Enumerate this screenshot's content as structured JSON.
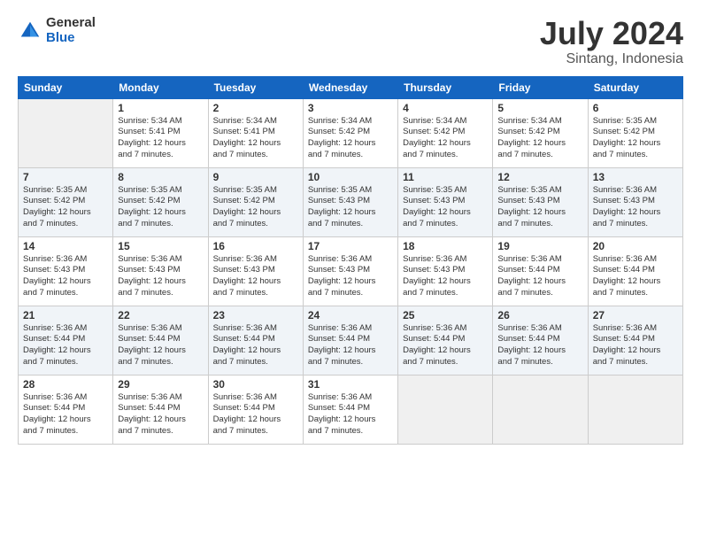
{
  "logo": {
    "general": "General",
    "blue": "Blue"
  },
  "title": "July 2024",
  "subtitle": "Sintang, Indonesia",
  "days_header": [
    "Sunday",
    "Monday",
    "Tuesday",
    "Wednesday",
    "Thursday",
    "Friday",
    "Saturday"
  ],
  "weeks": [
    [
      {
        "day": "",
        "info": ""
      },
      {
        "day": "1",
        "info": "Sunrise: 5:34 AM\nSunset: 5:41 PM\nDaylight: 12 hours\nand 7 minutes."
      },
      {
        "day": "2",
        "info": "Sunrise: 5:34 AM\nSunset: 5:41 PM\nDaylight: 12 hours\nand 7 minutes."
      },
      {
        "day": "3",
        "info": "Sunrise: 5:34 AM\nSunset: 5:42 PM\nDaylight: 12 hours\nand 7 minutes."
      },
      {
        "day": "4",
        "info": "Sunrise: 5:34 AM\nSunset: 5:42 PM\nDaylight: 12 hours\nand 7 minutes."
      },
      {
        "day": "5",
        "info": "Sunrise: 5:34 AM\nSunset: 5:42 PM\nDaylight: 12 hours\nand 7 minutes."
      },
      {
        "day": "6",
        "info": "Sunrise: 5:35 AM\nSunset: 5:42 PM\nDaylight: 12 hours\nand 7 minutes."
      }
    ],
    [
      {
        "day": "7",
        "info": "Sunrise: 5:35 AM\nSunset: 5:42 PM\nDaylight: 12 hours\nand 7 minutes."
      },
      {
        "day": "8",
        "info": "Sunrise: 5:35 AM\nSunset: 5:42 PM\nDaylight: 12 hours\nand 7 minutes."
      },
      {
        "day": "9",
        "info": "Sunrise: 5:35 AM\nSunset: 5:42 PM\nDaylight: 12 hours\nand 7 minutes."
      },
      {
        "day": "10",
        "info": "Sunrise: 5:35 AM\nSunset: 5:43 PM\nDaylight: 12 hours\nand 7 minutes."
      },
      {
        "day": "11",
        "info": "Sunrise: 5:35 AM\nSunset: 5:43 PM\nDaylight: 12 hours\nand 7 minutes."
      },
      {
        "day": "12",
        "info": "Sunrise: 5:35 AM\nSunset: 5:43 PM\nDaylight: 12 hours\nand 7 minutes."
      },
      {
        "day": "13",
        "info": "Sunrise: 5:36 AM\nSunset: 5:43 PM\nDaylight: 12 hours\nand 7 minutes."
      }
    ],
    [
      {
        "day": "14",
        "info": "Sunrise: 5:36 AM\nSunset: 5:43 PM\nDaylight: 12 hours\nand 7 minutes."
      },
      {
        "day": "15",
        "info": "Sunrise: 5:36 AM\nSunset: 5:43 PM\nDaylight: 12 hours\nand 7 minutes."
      },
      {
        "day": "16",
        "info": "Sunrise: 5:36 AM\nSunset: 5:43 PM\nDaylight: 12 hours\nand 7 minutes."
      },
      {
        "day": "17",
        "info": "Sunrise: 5:36 AM\nSunset: 5:43 PM\nDaylight: 12 hours\nand 7 minutes."
      },
      {
        "day": "18",
        "info": "Sunrise: 5:36 AM\nSunset: 5:43 PM\nDaylight: 12 hours\nand 7 minutes."
      },
      {
        "day": "19",
        "info": "Sunrise: 5:36 AM\nSunset: 5:44 PM\nDaylight: 12 hours\nand 7 minutes."
      },
      {
        "day": "20",
        "info": "Sunrise: 5:36 AM\nSunset: 5:44 PM\nDaylight: 12 hours\nand 7 minutes."
      }
    ],
    [
      {
        "day": "21",
        "info": "Sunrise: 5:36 AM\nSunset: 5:44 PM\nDaylight: 12 hours\nand 7 minutes."
      },
      {
        "day": "22",
        "info": "Sunrise: 5:36 AM\nSunset: 5:44 PM\nDaylight: 12 hours\nand 7 minutes."
      },
      {
        "day": "23",
        "info": "Sunrise: 5:36 AM\nSunset: 5:44 PM\nDaylight: 12 hours\nand 7 minutes."
      },
      {
        "day": "24",
        "info": "Sunrise: 5:36 AM\nSunset: 5:44 PM\nDaylight: 12 hours\nand 7 minutes."
      },
      {
        "day": "25",
        "info": "Sunrise: 5:36 AM\nSunset: 5:44 PM\nDaylight: 12 hours\nand 7 minutes."
      },
      {
        "day": "26",
        "info": "Sunrise: 5:36 AM\nSunset: 5:44 PM\nDaylight: 12 hours\nand 7 minutes."
      },
      {
        "day": "27",
        "info": "Sunrise: 5:36 AM\nSunset: 5:44 PM\nDaylight: 12 hours\nand 7 minutes."
      }
    ],
    [
      {
        "day": "28",
        "info": "Sunrise: 5:36 AM\nSunset: 5:44 PM\nDaylight: 12 hours\nand 7 minutes."
      },
      {
        "day": "29",
        "info": "Sunrise: 5:36 AM\nSunset: 5:44 PM\nDaylight: 12 hours\nand 7 minutes."
      },
      {
        "day": "30",
        "info": "Sunrise: 5:36 AM\nSunset: 5:44 PM\nDaylight: 12 hours\nand 7 minutes."
      },
      {
        "day": "31",
        "info": "Sunrise: 5:36 AM\nSunset: 5:44 PM\nDaylight: 12 hours\nand 7 minutes."
      },
      {
        "day": "",
        "info": ""
      },
      {
        "day": "",
        "info": ""
      },
      {
        "day": "",
        "info": ""
      }
    ]
  ]
}
